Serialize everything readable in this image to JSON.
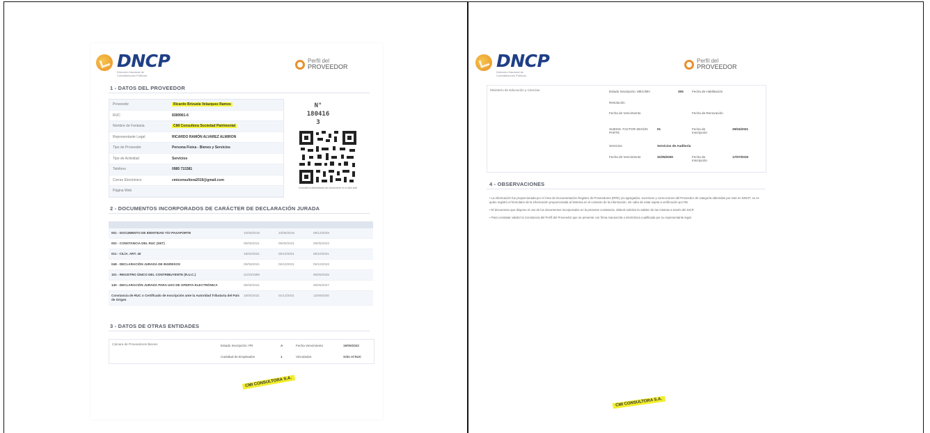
{
  "left": {
    "brand": "DNCP",
    "brand_tag": "Dirección Nacional de Contrataciones Públicas",
    "perfil_line1": "Perfil del",
    "perfil_line2": "PROVEEDOR",
    "sec1_title": "1 - DATOS DEL PROVEEDOR",
    "provider_rows": [
      {
        "k": "Proveedor",
        "v": "Ricardo Brizuela Velazquez Ramos"
      },
      {
        "k": "RUC",
        "v": "8389961-6"
      },
      {
        "k": "Nombre de Fantasía",
        "v": "CMI Consultora Sociedad Patrimonial"
      },
      {
        "k": "Representante Legal",
        "v": "RICARDO RAMÓN ALVAREZ ALMIRON"
      },
      {
        "k": "Tipo de Proveedor",
        "v": "Persona Física - Bienes y Servicios"
      },
      {
        "k": "Tipo de Actividad",
        "v": "Servicios"
      },
      {
        "k": "Teléfono",
        "v": "0985 715381"
      },
      {
        "k": "Correo Electrónico",
        "v": "cmiconsultora2019@gmail.com"
      },
      {
        "k": "Página Web",
        "v": ""
      }
    ],
    "numero_label": "N°",
    "numero_1": "180416",
    "numero_2": "3",
    "qr_caption": "Consulte la autenticidad del documento en el sitio web",
    "sec2_title": "2 - DOCUMENTOS INCORPORADOS DE CARÁCTER DE DECLARACIÓN JURADA",
    "doc_rows": [
      {
        "n": "001 - DOCUMENTO DE IDENTIDAD Y/O PASAPORTE",
        "c1": "10/06/2019",
        "c2": "10/06/2019",
        "c3": "09/12/2029"
      },
      {
        "n": "002 - CONSTANCIA DEL RUC (SET)",
        "c1": "05/05/2021",
        "c2": "05/05/2021",
        "c3": "05/05/2022"
      },
      {
        "n": "011 - CIL/A. ART. 40",
        "c1": "19/04/2021",
        "c2": "05/10/2021",
        "c3": "05/10/2021"
      },
      {
        "n": "048 - DECLARACIÓN JURADA DE INGRESOS",
        "c1": "05/05/2021",
        "c2": "05/10/2021",
        "c3": "05/10/2023"
      },
      {
        "n": "101 - REGISTRO ÚNICO DEL CONTRIBUYENTE (R.U.C.)",
        "c1": "21/03/1999",
        "c2": "",
        "c3": "05/05/2025"
      },
      {
        "n": "140 - DECLARACIÓN JURADA PARA USO DE OFERTA ELECTRÓNICA",
        "c1": "05/05/2021",
        "c2": "",
        "c3": "05/05/2027"
      },
      {
        "n": "Constancia de RUC o Certificado de Inscripción ante la Autoridad Tributaria del País de Origen",
        "c1": "19/05/2021",
        "c2": "01/12/2021",
        "c3": "12/09/2030"
      }
    ],
    "sec3_title": "3 - DATOS DE OTRAS ENTIDADES",
    "other_label": "Cámara de Proveedores Bienes",
    "other_r1": [
      "Estado Inscripción: PR",
      "A",
      "Fecha Vencimiento",
      "19/05/2022"
    ],
    "other_r2": [
      "Cantidad de Empleados",
      "1",
      "Vinculados",
      "Sólo el RUC"
    ],
    "stamp_text": "CMI CONSULTORA S.A."
  },
  "right": {
    "brand": "DNCP",
    "brand_tag": "Dirección Nacional de Contrataciones Públicas",
    "perfil_line1": "Perfil del",
    "perfil_line2": "PROVEEDOR",
    "ent_label": "Ministerio de Educación y Ciencias",
    "r1": [
      "Estado Inscripción: MEC/MH",
      "SIN",
      "Fecha de Habilitación"
    ],
    "r2": [
      "Resolución",
      ""
    ],
    "r3": [
      "Fecha de Vencimiento",
      "",
      "Fecha de Renovación"
    ],
    "r4": [
      "SUBSIS. FACTOR SEGÚN PARTE",
      "01",
      "Fecha de Inscripción",
      "29/04/2021"
    ],
    "r5": [
      "Servicios",
      "Servicios de Auditoría"
    ],
    "r6": [
      "Fecha de Vencimiento",
      "31/05/2030",
      "Fecha de Inscripción",
      "17/07/2019"
    ],
    "sec4_title": "4 - OBSERVACIONES",
    "obs": [
      "• La información fue proporcionada por el Área de Documentación Registro de Proveedores (RPE) y/o agregados, sucesivos y correcciones del Proveedor de categoría obtenidas por este en DNCP; se ve quien registró el formulario de la información proporcionada al Sistema en el contexto de la información, sin cabo de estar sujeta a verificación por RE.",
      "• El documento que dispone el uso de los documentos incorporados en la presente constancia, deberá solicitar la validez de las mismas a través del SICP.",
      "• Para constatar validez la Constancia del Perfil del Proveedor que se presente con firma manuscrita o electrónica cualificada por su representante legal."
    ],
    "stamp_text": "CMI CONSULTORA S.A."
  }
}
